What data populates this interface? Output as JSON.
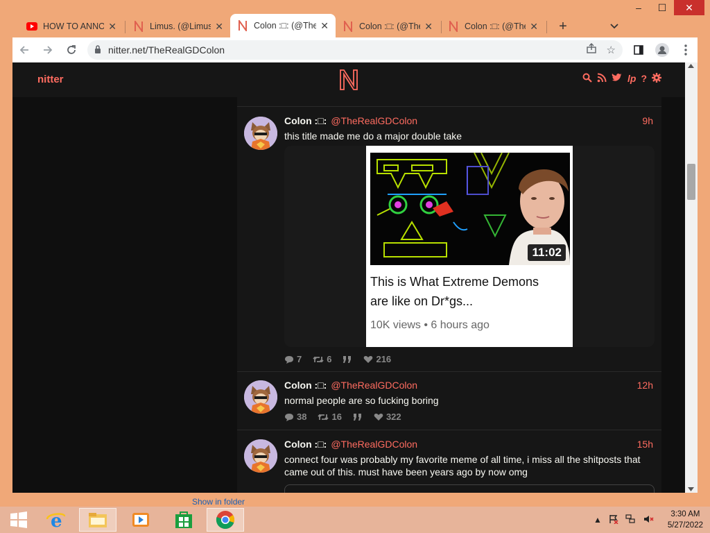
{
  "window": {
    "minimize": "–",
    "maximize": "☐",
    "close": "✕"
  },
  "tabs": [
    {
      "label": "HOW TO ANNO",
      "icon": "youtube-icon",
      "active": false
    },
    {
      "label": "Limus. (@LimusT",
      "icon": "nitter-icon",
      "active": false
    },
    {
      "label": "Colon :□: (@The",
      "icon": "nitter-icon",
      "active": true
    },
    {
      "label": "Colon :□: (@The",
      "icon": "nitter-icon",
      "active": false
    },
    {
      "label": "Colon :□: (@The",
      "icon": "nitter-icon",
      "active": false
    }
  ],
  "new_tab": "+",
  "tab_search": "⌄",
  "address": {
    "url": "nitter.net/TheRealGDColon"
  },
  "nitter": {
    "brand": "nitter",
    "accent": "#ff6c60",
    "nav_icons": [
      "search-icon",
      "rss-icon",
      "twitter-icon",
      "liberapay-icon",
      "help-icon",
      "settings-icon"
    ]
  },
  "tweets": [
    {
      "name": "Colon :□:",
      "handle": "@TheRealGDColon",
      "time": "9h",
      "text": "this title made me do a major double take",
      "card": {
        "duration": "11:02",
        "title": "This is What Extreme Demons are like on Dr*gs...",
        "meta": "10K views • 6 hours ago"
      },
      "stats": {
        "replies": "7",
        "retweets": "6",
        "likes": "216"
      }
    },
    {
      "name": "Colon :□:",
      "handle": "@TheRealGDColon",
      "time": "12h",
      "text": "normal people are so fucking boring",
      "stats": {
        "replies": "38",
        "retweets": "16",
        "likes": "322"
      }
    },
    {
      "name": "Colon :□:",
      "handle": "@TheRealGDColon",
      "time": "15h",
      "text": "connect four was probably my favorite meme of all time, i miss all the shitposts that came out of this. must have been years ago by now omg"
    }
  ],
  "download_shelf": {
    "show_in_folder": "Show in folder"
  },
  "taskbar": {
    "apps": [
      "start-button",
      "internet-explorer-icon",
      "file-explorer-icon",
      "media-player-icon",
      "store-icon",
      "chrome-icon"
    ],
    "time": "3:30 AM",
    "date": "5/27/2022"
  }
}
